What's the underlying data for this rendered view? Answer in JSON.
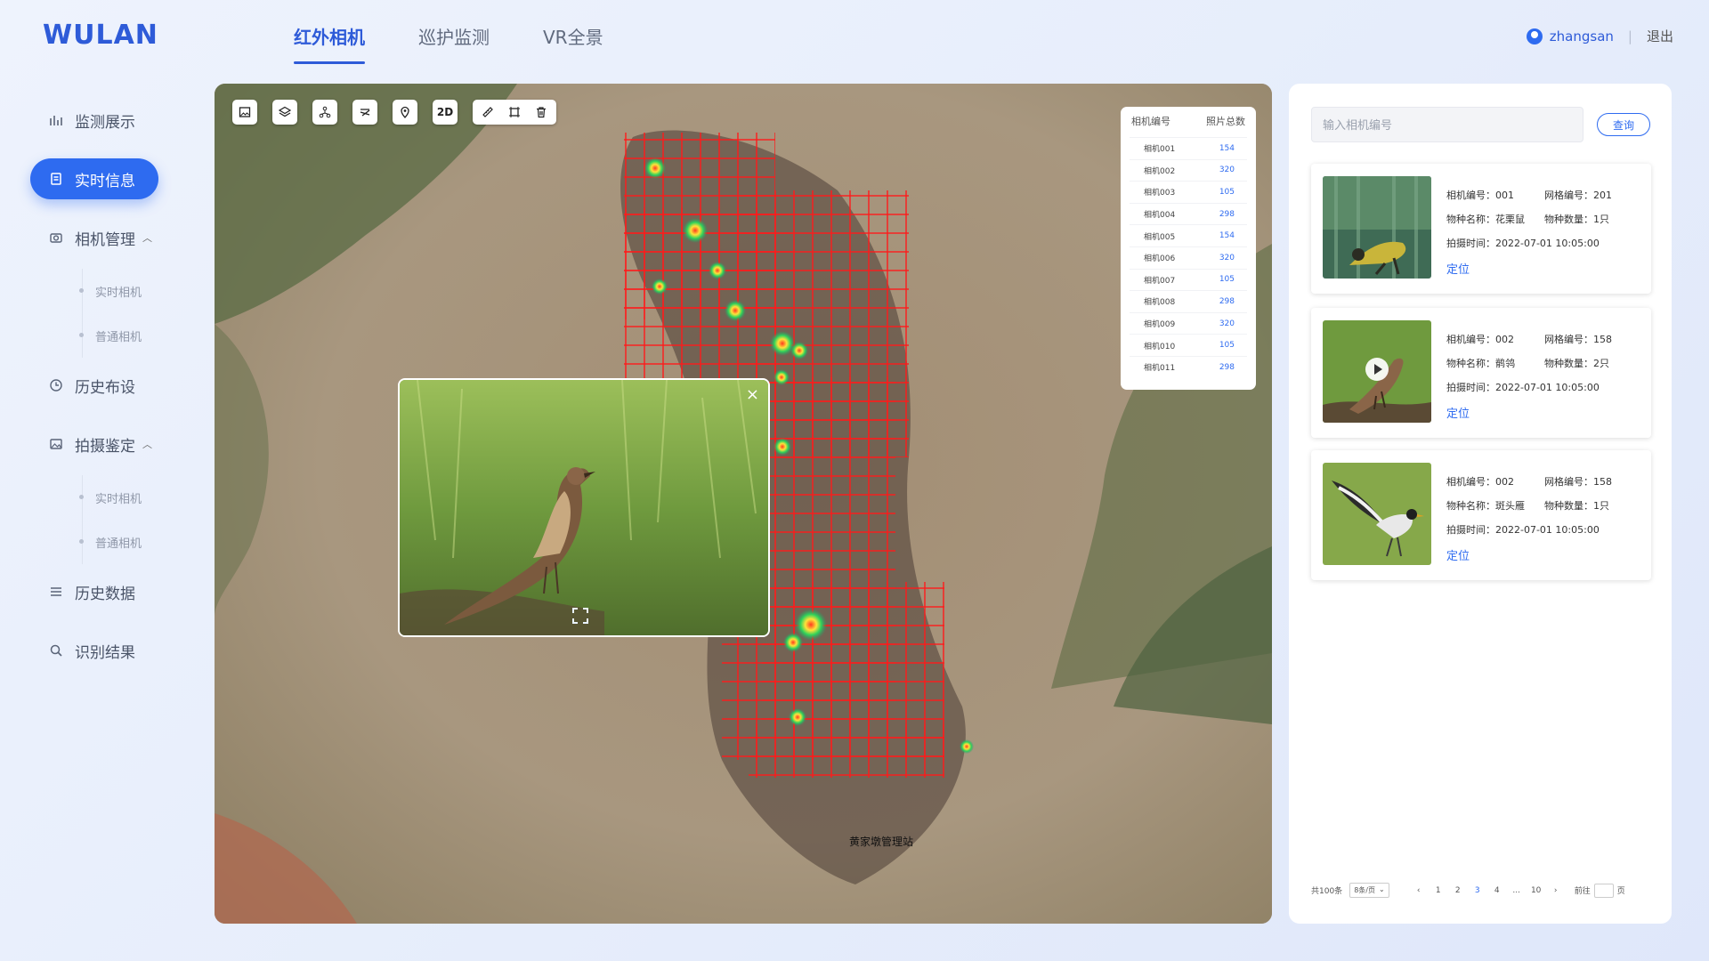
{
  "app": {
    "logo": "WULAN"
  },
  "topnav": [
    {
      "label": "红外相机",
      "active": true
    },
    {
      "label": "巡护监测",
      "active": false
    },
    {
      "label": "VR全景",
      "active": false
    }
  ],
  "user": {
    "name": "zhangsan",
    "separator": "|",
    "logout": "退出"
  },
  "sidebar": {
    "items": [
      {
        "label": "监测展示",
        "icon": "chart-icon"
      },
      {
        "label": "实时信息",
        "icon": "document-icon",
        "active": true
      },
      {
        "label": "相机管理",
        "icon": "camera-icon",
        "expanded": true,
        "children": [
          "实时相机",
          "普通相机"
        ]
      },
      {
        "label": "历史布设",
        "icon": "clock-icon"
      },
      {
        "label": "拍摄鉴定",
        "icon": "image-icon",
        "expanded": true,
        "children": [
          "实时相机",
          "普通相机"
        ]
      },
      {
        "label": "历史数据",
        "icon": "list-icon"
      },
      {
        "label": "识别结果",
        "icon": "search-icon"
      }
    ]
  },
  "map": {
    "toolbar": {
      "mode_label": "2D",
      "tools": [
        "image-icon",
        "layers-icon",
        "network-icon",
        "stack-icon",
        "location-pin-icon",
        "2d-toggle",
        "ruler-icon",
        "crop-icon",
        "trash-icon"
      ]
    },
    "camera_table": {
      "headers": [
        "相机编号",
        "照片总数"
      ],
      "rows": [
        {
          "id": "相机001",
          "count": "154"
        },
        {
          "id": "相机002",
          "count": "320"
        },
        {
          "id": "相机003",
          "count": "105"
        },
        {
          "id": "相机004",
          "count": "298"
        },
        {
          "id": "相机005",
          "count": "154"
        },
        {
          "id": "相机006",
          "count": "320"
        },
        {
          "id": "相机007",
          "count": "105"
        },
        {
          "id": "相机008",
          "count": "298"
        },
        {
          "id": "相机009",
          "count": "320"
        },
        {
          "id": "相机010",
          "count": "105"
        },
        {
          "id": "相机011",
          "count": "298"
        }
      ]
    },
    "station_label": "黄家墩管理站",
    "popup": {
      "close": "×"
    }
  },
  "panel": {
    "search_placeholder": "输入相机编号",
    "query_label": "查询",
    "cards": [
      {
        "cam": "相机编号：001",
        "grid": "网格编号：201",
        "species": "物种名称：花栗鼠",
        "qty": "物种数量：1只",
        "time": "拍摄时间：2022-07-01   10:05:00",
        "locate": "定位"
      },
      {
        "cam": "相机编号：002",
        "grid": "网格编号：158",
        "species": "物种名称：鹡鸰",
        "qty": "物种数量：2只",
        "time": "拍摄时间：2022-07-01   10:05:00",
        "locate": "定位"
      },
      {
        "cam": "相机编号：002",
        "grid": "网格编号：158",
        "species": "物种名称：斑头雁",
        "qty": "物种数量：1只",
        "time": "拍摄时间：2022-07-01   10:05:00",
        "locate": "定位"
      }
    ],
    "pager": {
      "total": "共100条",
      "size": "8条/页",
      "pages": [
        "1",
        "2",
        "3",
        "4",
        "...",
        "10"
      ],
      "current": "3",
      "goto": "前往",
      "page_unit": "页"
    }
  }
}
